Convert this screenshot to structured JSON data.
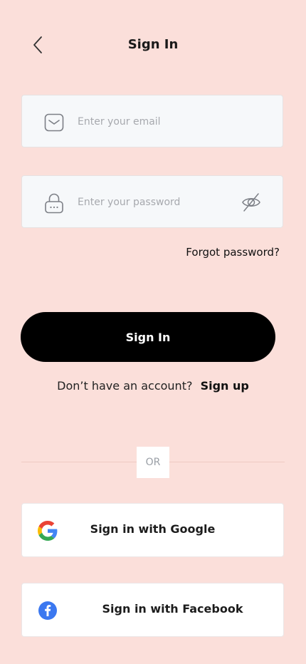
{
  "header": {
    "title": "Sign In",
    "back_icon": "chevron-left-icon"
  },
  "form": {
    "email": {
      "placeholder": "Enter your email",
      "value": "",
      "icon": "mail-icon"
    },
    "password": {
      "placeholder": "Enter your password",
      "value": "",
      "icon": "lock-icon",
      "toggle_icon": "eye-off-icon"
    },
    "forgot_label": "Forgot password?",
    "submit_label": "Sign In"
  },
  "signup": {
    "prompt": "Don’t have an account?",
    "link_label": "Sign up"
  },
  "divider": {
    "label": "OR"
  },
  "social": {
    "google_label": "Sign in with Google",
    "facebook_label": "Sign in with Facebook",
    "google_icon": "google-logo-icon",
    "facebook_icon": "facebook-logo-icon"
  },
  "colors": {
    "background": "#FBDFDA",
    "primary_button": "#000000",
    "field_background": "#F6F8FA",
    "facebook_blue": "#3B78F0"
  }
}
